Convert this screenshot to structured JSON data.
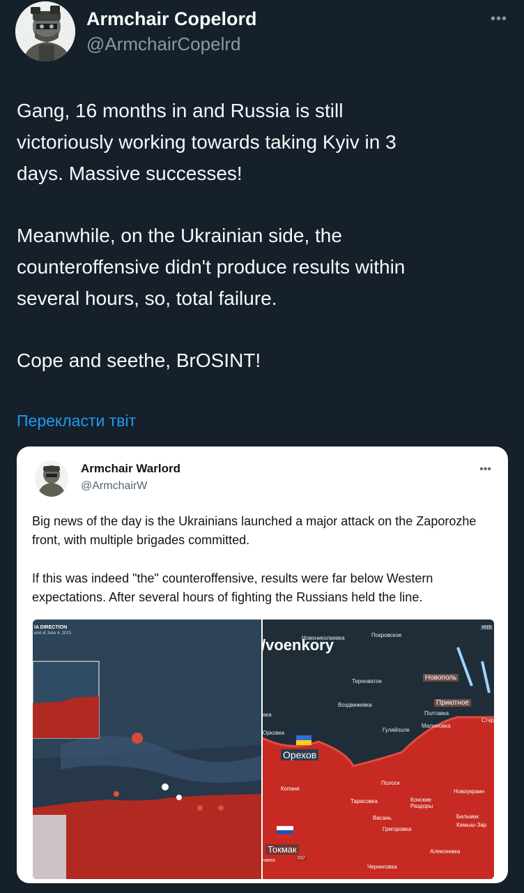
{
  "author": {
    "name": "Armchair Copelord",
    "handle": "@ArmchairCopelrd",
    "more_glyph": "•••"
  },
  "tweet": {
    "paragraphs": [
      "Gang, 16 months in and Russia is still\nvictoriously working towards taking Kyiv in 3\ndays. Massive successes!",
      "Meanwhile, on the Ukrainian side, the\ncounteroffensive didn't produce results within\nseveral hours, so, total failure.",
      "Cope and seethe, BrOSINT!"
    ],
    "translate_link": "Перекласти твіт"
  },
  "quoted": {
    "name": "Armchair Warlord",
    "handle": "@ArmchairW",
    "more_glyph": "•••",
    "paragraphs": [
      "Big news of the day is the Ukrainians launched a major attack on the Zaporozhe front, with multiple brigades committed.",
      "If this was indeed \"the\" counteroffensive, results were far below Western expectations.  After several hours of fighting the Russians held the line."
    ],
    "left_map": {
      "title": "IA DIRECTION",
      "subtitle": "end of June 4, 2023"
    },
    "right_map": {
      "watermark": "/voenkory",
      "road_tag": "H15",
      "labels": {
        "novonikolaevka": "Новониколаевка",
        "pokrovskoe": "Покровское",
        "ternovatoe": "Терноватое",
        "novopol": "Новополь",
        "vozdvizhevka": "Воздвижевка",
        "priyutnoe": "Приютное",
        "poltavka": "Полтавка",
        "guliaipole": "Гуляйполе",
        "malinovka": "Малиновка",
        "star": "Стар",
        "orekhovka": "Орковка",
        "aka": "ака",
        "orekhov": "Орехов",
        "kopani": "Копани",
        "pologi": "Пологи",
        "novoukrainka": "Новоукраин",
        "tarasovka": "Тарасовка",
        "konskie": "Конские\nРаздоры",
        "vasilevka": "Васань",
        "grigorovka": "Григоровка",
        "bilmak": "Бильмак",
        "kamysh": "Камыш-Зар",
        "tokmak": "Токмак",
        "chansk": "чанск",
        "aleksevka": "Алексеевка",
        "chernigovka": "Черниговка",
        "r37": "P37"
      }
    }
  },
  "colors": {
    "background": "#15202b",
    "link": "#1d9bf0",
    "secondary": "#8b98a5",
    "russian_red": "#c62a22",
    "map_dark": "#1f2d38"
  }
}
